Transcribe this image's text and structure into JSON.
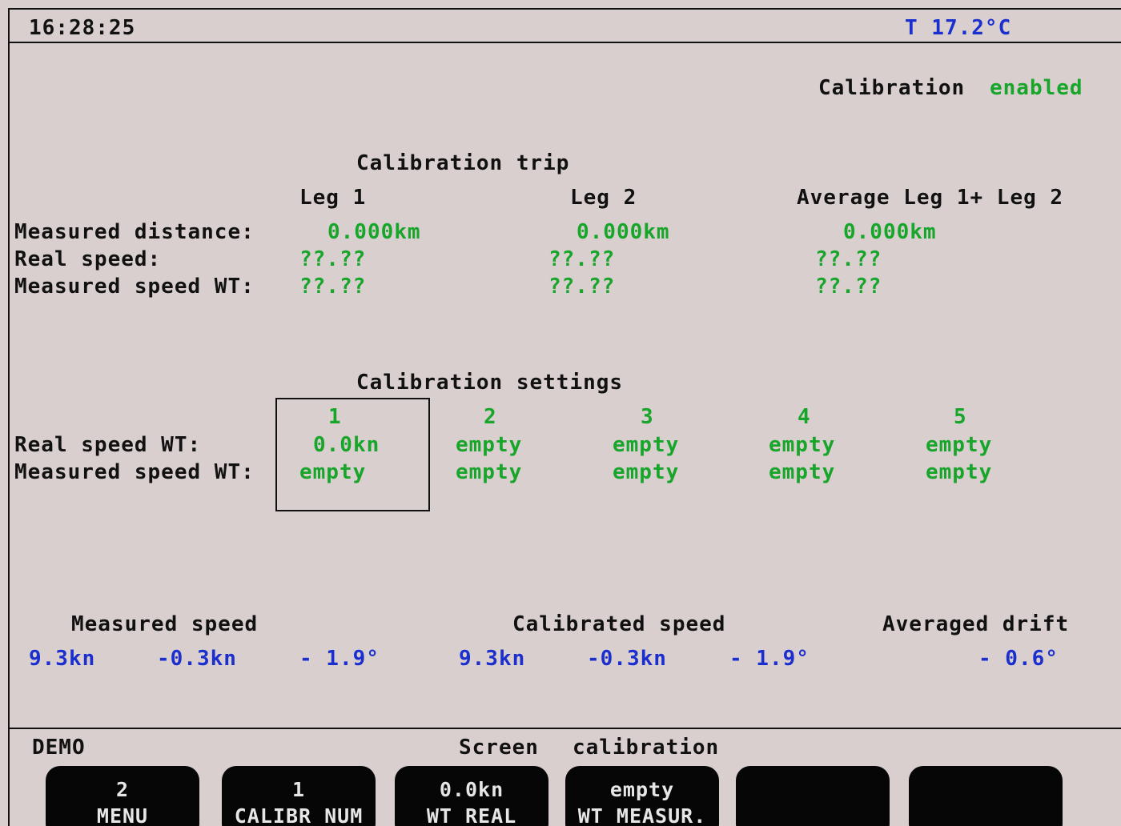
{
  "header": {
    "time": "16:28:25",
    "temperature": "T 17.2°C"
  },
  "calibration_status": {
    "label": "Calibration",
    "value": "enabled"
  },
  "trip": {
    "title": "Calibration trip",
    "columns": [
      "Leg 1",
      "Leg 2",
      "Average Leg 1+ Leg 2"
    ],
    "rows": [
      {
        "label": "Measured distance:",
        "values": [
          "0.000km",
          "0.000km",
          "0.000km"
        ]
      },
      {
        "label": "Real speed:",
        "values": [
          "??.??",
          "??.??",
          "??.??"
        ]
      },
      {
        "label": "Measured speed WT:",
        "values": [
          "??.??",
          "??.??",
          "??.??"
        ]
      }
    ]
  },
  "settings": {
    "title": "Calibration settings",
    "selected_slot": "1",
    "slots": [
      "1",
      "2",
      "3",
      "4",
      "5"
    ],
    "rows": [
      {
        "label": "Real speed WT:",
        "values": [
          "0.0kn",
          "empty",
          "empty",
          "empty",
          "empty"
        ]
      },
      {
        "label": "Measured speed WT:",
        "values": [
          "empty",
          "empty",
          "empty",
          "empty",
          "empty"
        ]
      }
    ]
  },
  "readouts": {
    "measured_speed": {
      "label": "Measured speed",
      "values": [
        "9.3kn",
        "-0.3kn",
        "- 1.9°"
      ]
    },
    "calibrated_speed": {
      "label": "Calibrated speed",
      "values": [
        "9.3kn",
        "-0.3kn",
        "- 1.9°"
      ]
    },
    "averaged_drift": {
      "label": "Averaged drift",
      "value": "- 0.6°"
    }
  },
  "footer": {
    "mode": "DEMO",
    "screen_label": "Screen",
    "screen_name": "calibration"
  },
  "softkeys": [
    {
      "line1": "2",
      "line2": "MENU"
    },
    {
      "line1": "1",
      "line2": "CALIBR NUM"
    },
    {
      "line1": "0.0kn",
      "line2": "WT REAL"
    },
    {
      "line1": "empty",
      "line2": "WT MEASUR."
    },
    {
      "line1": "",
      "line2": ""
    },
    {
      "line1": "",
      "line2": ""
    }
  ],
  "colors": {
    "background": "#d9cfcf",
    "value_green": "#17a52a",
    "value_blue": "#1b2fcf",
    "softkey_bg": "#060606"
  }
}
